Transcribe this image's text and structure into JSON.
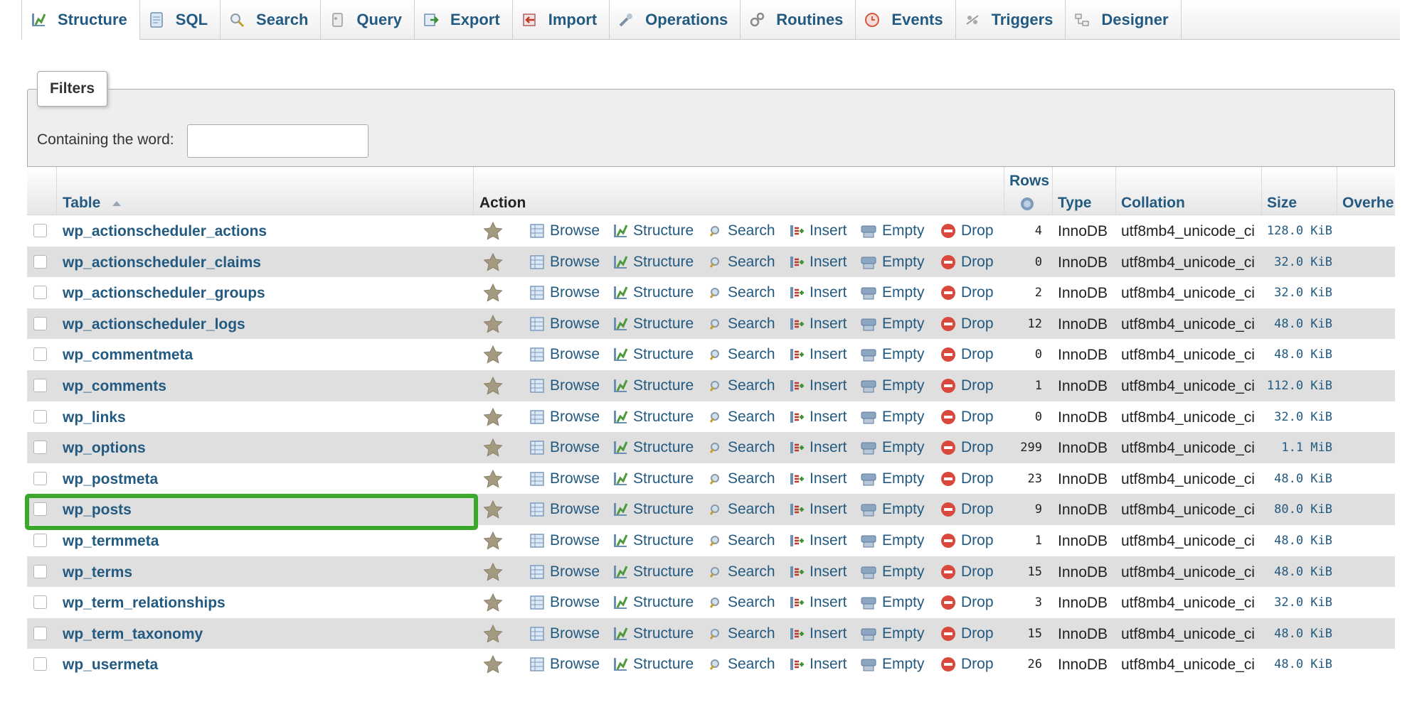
{
  "tabs": [
    {
      "label": "Structure",
      "icon": "structure-icon",
      "active": true
    },
    {
      "label": "SQL",
      "icon": "sql-icon"
    },
    {
      "label": "Search",
      "icon": "search-icon"
    },
    {
      "label": "Query",
      "icon": "query-icon"
    },
    {
      "label": "Export",
      "icon": "export-icon"
    },
    {
      "label": "Import",
      "icon": "import-icon"
    },
    {
      "label": "Operations",
      "icon": "wrench-icon"
    },
    {
      "label": "Routines",
      "icon": "routines-icon"
    },
    {
      "label": "Events",
      "icon": "clock-icon"
    },
    {
      "label": "Triggers",
      "icon": "triggers-icon"
    },
    {
      "label": "Designer",
      "icon": "designer-icon"
    }
  ],
  "filters": {
    "legend": "Filters",
    "label": "Containing the word:",
    "value": ""
  },
  "table_header": {
    "table": "Table",
    "action": "Action",
    "rows": "Rows",
    "type": "Type",
    "collation": "Collation",
    "size": "Size",
    "overhead": "Overhe"
  },
  "actions": {
    "browse": "Browse",
    "structure": "Structure",
    "search": "Search",
    "insert": "Insert",
    "empty": "Empty",
    "drop": "Drop"
  },
  "colors": {
    "link": "#235a81",
    "highlight": "#3aa82b",
    "drop": "#d9483b"
  },
  "rows": [
    {
      "name": "wp_actionscheduler_actions",
      "rows": "4",
      "type": "InnoDB",
      "collation": "utf8mb4_unicode_ci",
      "size": "128.0 KiB"
    },
    {
      "name": "wp_actionscheduler_claims",
      "rows": "0",
      "type": "InnoDB",
      "collation": "utf8mb4_unicode_ci",
      "size": "32.0 KiB"
    },
    {
      "name": "wp_actionscheduler_groups",
      "rows": "2",
      "type": "InnoDB",
      "collation": "utf8mb4_unicode_ci",
      "size": "32.0 KiB"
    },
    {
      "name": "wp_actionscheduler_logs",
      "rows": "12",
      "type": "InnoDB",
      "collation": "utf8mb4_unicode_ci",
      "size": "48.0 KiB"
    },
    {
      "name": "wp_commentmeta",
      "rows": "0",
      "type": "InnoDB",
      "collation": "utf8mb4_unicode_ci",
      "size": "48.0 KiB"
    },
    {
      "name": "wp_comments",
      "rows": "1",
      "type": "InnoDB",
      "collation": "utf8mb4_unicode_ci",
      "size": "112.0 KiB"
    },
    {
      "name": "wp_links",
      "rows": "0",
      "type": "InnoDB",
      "collation": "utf8mb4_unicode_ci",
      "size": "32.0 KiB"
    },
    {
      "name": "wp_options",
      "rows": "299",
      "type": "InnoDB",
      "collation": "utf8mb4_unicode_ci",
      "size": "1.1 MiB"
    },
    {
      "name": "wp_postmeta",
      "rows": "23",
      "type": "InnoDB",
      "collation": "utf8mb4_unicode_ci",
      "size": "48.0 KiB"
    },
    {
      "name": "wp_posts",
      "rows": "9",
      "type": "InnoDB",
      "collation": "utf8mb4_unicode_ci",
      "size": "80.0 KiB",
      "highlighted": true
    },
    {
      "name": "wp_termmeta",
      "rows": "1",
      "type": "InnoDB",
      "collation": "utf8mb4_unicode_ci",
      "size": "48.0 KiB"
    },
    {
      "name": "wp_terms",
      "rows": "15",
      "type": "InnoDB",
      "collation": "utf8mb4_unicode_ci",
      "size": "48.0 KiB"
    },
    {
      "name": "wp_term_relationships",
      "rows": "3",
      "type": "InnoDB",
      "collation": "utf8mb4_unicode_ci",
      "size": "32.0 KiB"
    },
    {
      "name": "wp_term_taxonomy",
      "rows": "15",
      "type": "InnoDB",
      "collation": "utf8mb4_unicode_ci",
      "size": "48.0 KiB"
    },
    {
      "name": "wp_usermeta",
      "rows": "26",
      "type": "InnoDB",
      "collation": "utf8mb4_unicode_ci",
      "size": "48.0 KiB"
    }
  ]
}
